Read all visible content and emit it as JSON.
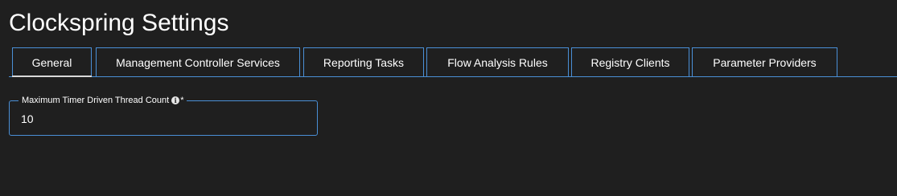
{
  "page": {
    "title": "Clockspring Settings"
  },
  "tabs": [
    {
      "label": "General",
      "active": true
    },
    {
      "label": "Management Controller Services",
      "active": false
    },
    {
      "label": "Reporting Tasks",
      "active": false
    },
    {
      "label": "Flow Analysis Rules",
      "active": false
    },
    {
      "label": "Registry Clients",
      "active": false
    },
    {
      "label": "Parameter Providers",
      "active": false
    }
  ],
  "general": {
    "thread_count": {
      "label": "Maximum Timer Driven Thread Count",
      "info_icon": "info-icon",
      "required_marker": "*",
      "value": "10"
    }
  },
  "colors": {
    "background": "#1f1f1f",
    "accent": "#4a8fd6",
    "text": "#ffffff"
  }
}
